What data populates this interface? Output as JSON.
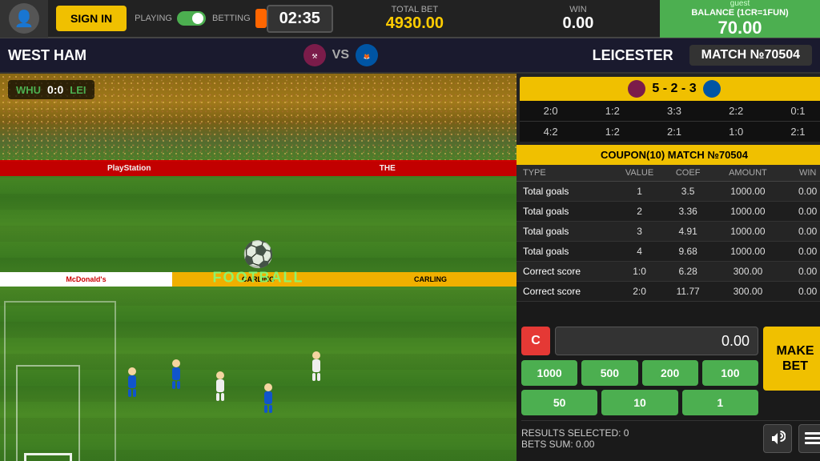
{
  "topbar": {
    "sign_in_label": "SIGN IN",
    "playing_label": "PLAYING",
    "betting_label": "BETTING",
    "timer": "02:35",
    "total_bet_label": "TOTAL BET",
    "total_bet_value": "4930.00",
    "win_label": "WIN",
    "win_value": "0.00",
    "guest_label": "guest",
    "balance_label": "BALANCE (1CR=1FUN)",
    "balance_value": "70.00"
  },
  "matchbar": {
    "home_team": "WEST HAM",
    "away_team": "LEICESTER",
    "vs": "VS",
    "match_label": "MATCH №70504"
  },
  "score_grid": {
    "home_score": "5",
    "separator": "-",
    "away_score1": "2",
    "separator2": "-",
    "away_score2": "3",
    "scores_row1": [
      "2:0",
      "1:2",
      "3:3",
      "2:2",
      "0:1"
    ],
    "scores_row2": [
      "4:2",
      "1:2",
      "2:1",
      "1:0",
      "2:1"
    ]
  },
  "coupon": {
    "header": "COUPON(10) MATCH №70504",
    "columns": [
      "TYPE",
      "VALUE",
      "COEF",
      "AMOUNT",
      "WIN"
    ],
    "rows": [
      {
        "type": "Total goals",
        "value": "1",
        "coef": "3.5",
        "amount": "1000.00",
        "win": "0.00"
      },
      {
        "type": "Total goals",
        "value": "2",
        "coef": "3.36",
        "amount": "1000.00",
        "win": "0.00"
      },
      {
        "type": "Total goals",
        "value": "3",
        "coef": "4.91",
        "amount": "1000.00",
        "win": "0.00"
      },
      {
        "type": "Total goals",
        "value": "4",
        "coef": "9.68",
        "amount": "1000.00",
        "win": "0.00"
      },
      {
        "type": "Correct score",
        "value": "1:0",
        "coef": "6.28",
        "amount": "300.00",
        "win": "0.00"
      },
      {
        "type": "Correct score",
        "value": "2:0",
        "coef": "11.77",
        "amount": "300.00",
        "win": "0.00"
      }
    ]
  },
  "controls": {
    "clear_label": "C",
    "bet_value": "0.00",
    "make_bet_label": "MAKE\nBET",
    "chips_row1": [
      "1000",
      "500",
      "200",
      "100"
    ],
    "chips_row2": [
      "50",
      "10",
      "1"
    ],
    "results_selected": "RESULTS SELECTED: 0",
    "bets_sum": "BETS SUM: 0.00"
  },
  "video": {
    "score_home_abbr": "WHU",
    "score_away_abbr": "LEI",
    "score": "0:0",
    "logo_text": "FOOTBALL",
    "football_icon": "⚽"
  }
}
